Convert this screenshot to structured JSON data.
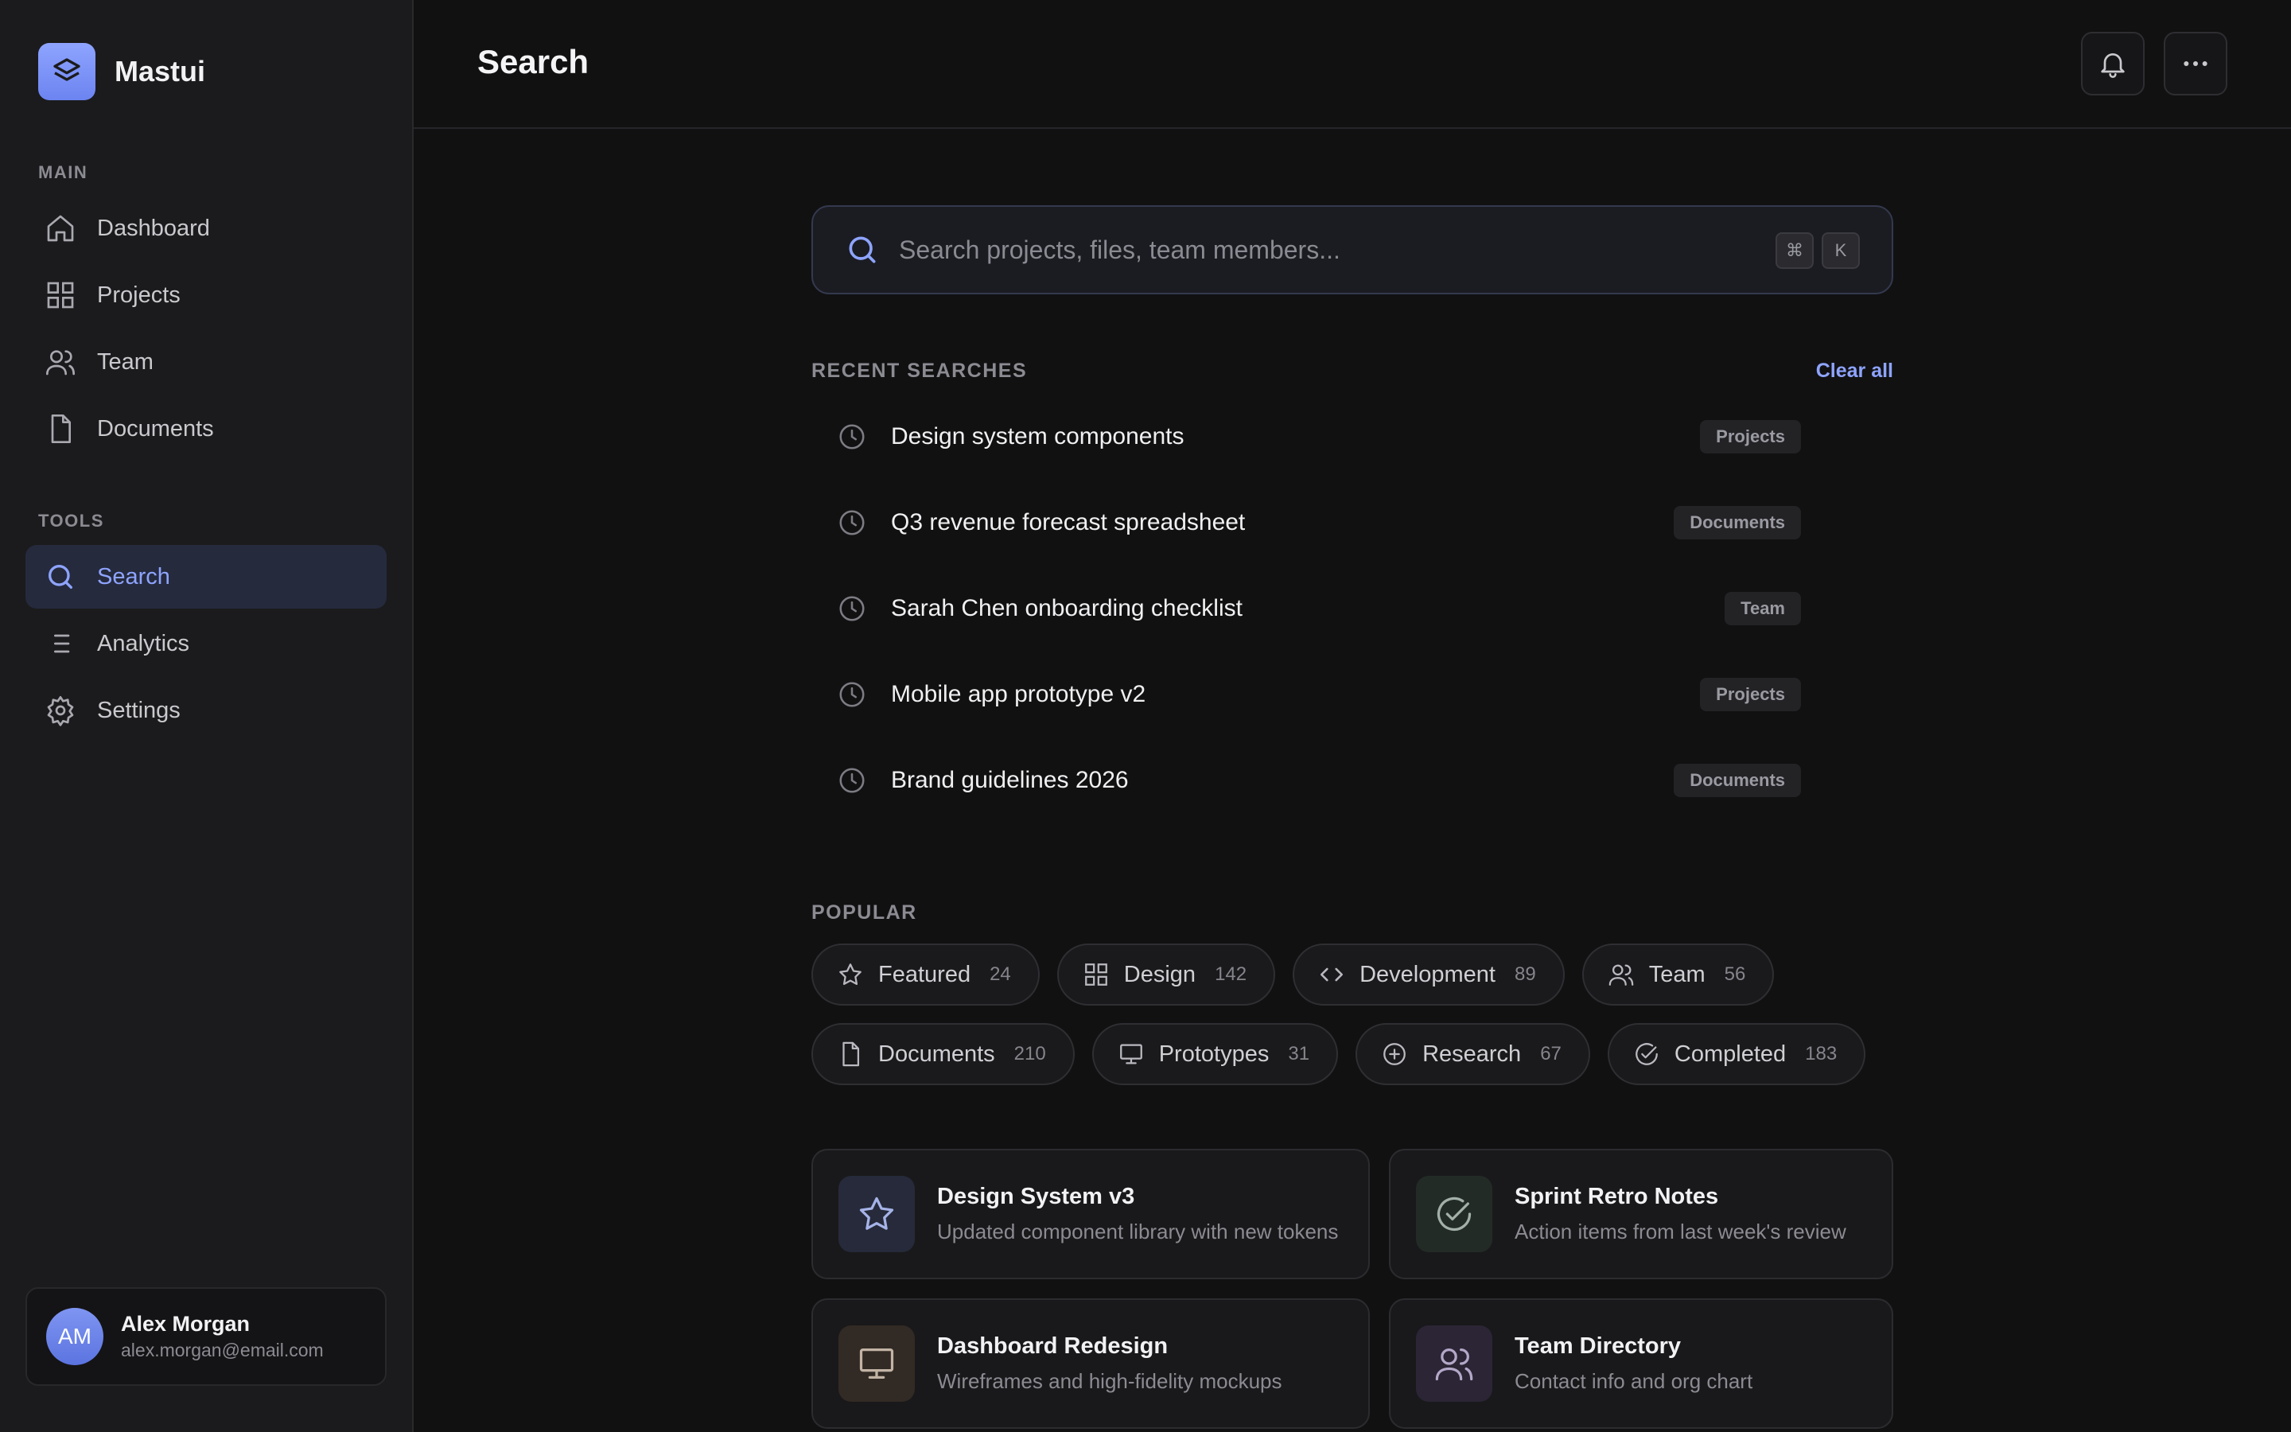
{
  "app": {
    "name": "Mastui",
    "logo_icon": "layers-icon",
    "accent": "#8ea4ff"
  },
  "sidebar": {
    "main_label": "MAIN",
    "main_items": [
      {
        "label": "Dashboard",
        "icon": "home-icon"
      },
      {
        "label": "Projects",
        "icon": "grid-icon"
      },
      {
        "label": "Team",
        "icon": "users-icon"
      },
      {
        "label": "Documents",
        "icon": "file-icon"
      }
    ],
    "tools_label": "TOOLS",
    "tools_items": [
      {
        "label": "Search",
        "icon": "search-icon",
        "active": true
      },
      {
        "label": "Analytics",
        "icon": "list-icon"
      },
      {
        "label": "Settings",
        "icon": "gear-icon"
      }
    ],
    "user": {
      "initials": "AM",
      "name": "Alex Morgan",
      "email": "alex.morgan@email.com"
    }
  },
  "header": {
    "title": "Search",
    "actions": [
      "bell-icon",
      "more-icon"
    ]
  },
  "search": {
    "placeholder": "Search projects, files, team members...",
    "value": "",
    "shortcut": [
      "⌘",
      "K"
    ]
  },
  "recent": {
    "label": "RECENT SEARCHES",
    "clear_label": "Clear all",
    "items": [
      {
        "text": "Design system components",
        "tag": "Projects"
      },
      {
        "text": "Q3 revenue forecast spreadsheet",
        "tag": "Documents"
      },
      {
        "text": "Sarah Chen onboarding checklist",
        "tag": "Team"
      },
      {
        "text": "Mobile app prototype v2",
        "tag": "Projects"
      },
      {
        "text": "Brand guidelines 2026",
        "tag": "Documents"
      }
    ]
  },
  "popular": {
    "label": "POPULAR",
    "chips": [
      {
        "label": "Featured",
        "count": "24",
        "icon": "star-icon"
      },
      {
        "label": "Design",
        "count": "142",
        "icon": "grid-icon"
      },
      {
        "label": "Development",
        "count": "89",
        "icon": "code-icon"
      },
      {
        "label": "Team",
        "count": "56",
        "icon": "users-icon"
      },
      {
        "label": "Documents",
        "count": "210",
        "icon": "file-icon"
      },
      {
        "label": "Prototypes",
        "count": "31",
        "icon": "monitor-icon"
      },
      {
        "label": "Research",
        "count": "67",
        "icon": "plus-circle-icon"
      },
      {
        "label": "Completed",
        "count": "183",
        "icon": "check-circle-icon"
      }
    ]
  },
  "cards": [
    {
      "title": "Design System v3",
      "desc": "Updated component library with new tokens",
      "icon": "star-icon",
      "bg": "#262a3a"
    },
    {
      "title": "Sprint Retro Notes",
      "desc": "Action items from last week's review",
      "icon": "check-circle-icon",
      "bg": "#232b27"
    },
    {
      "title": "Dashboard Redesign",
      "desc": "Wireframes and high-fidelity mockups",
      "icon": "monitor-icon",
      "bg": "#322a24"
    },
    {
      "title": "Team Directory",
      "desc": "Contact info and org chart",
      "icon": "users-icon",
      "bg": "#2b2535"
    }
  ]
}
